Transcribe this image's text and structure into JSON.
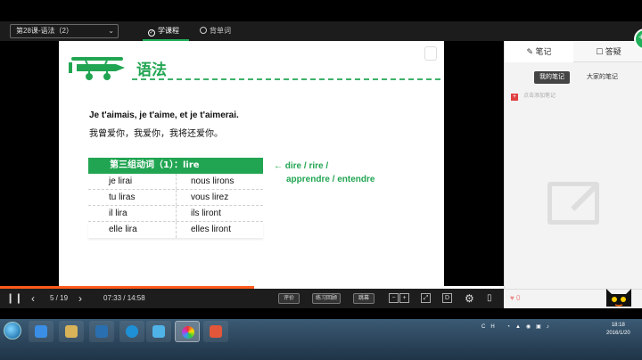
{
  "header": {
    "lesson_select": "第28课-语法（2）",
    "tabs": [
      {
        "label": "学课程",
        "active": true
      },
      {
        "label": "背单词",
        "active": false
      }
    ]
  },
  "slide": {
    "title": "语法",
    "french_line": "Je t'aimais, je t'aime, et je t'aimerai.",
    "chinese_line": "我曾爱你，我爱你，我将还爱你。",
    "table": {
      "header": "第三组动词（1）：lire",
      "rows": [
        [
          "je lirai",
          "nous lirons"
        ],
        [
          "tu liras",
          "vous lirez"
        ],
        [
          "il lira",
          "ils liront"
        ],
        [
          "elle lira",
          "elles liront"
        ]
      ]
    },
    "note_line1": "← dire / rire /",
    "note_line2": "apprendre / entendre"
  },
  "player": {
    "page": "5 / 19",
    "time": "07:33 / 14:58",
    "progress": 0.505,
    "buttons": {
      "rate": "评价",
      "practice": "练习回顾",
      "jump": "跳幕"
    }
  },
  "sidebar": {
    "tabs": [
      {
        "label": "笔记",
        "active": true
      },
      {
        "label": "答疑",
        "active": false
      }
    ],
    "subtabs": [
      {
        "label": "我的笔记",
        "active": true
      },
      {
        "label": "大家的笔记",
        "active": false
      }
    ],
    "add_note": "点击添加笔记",
    "likes": "0"
  },
  "taskbar": {
    "clock_time": "18:18",
    "clock_date": "2016/1/20",
    "tray_lang": "CH"
  },
  "colors": {
    "accent_green": "#21a552",
    "progress_orange": "#ff5a1c"
  }
}
